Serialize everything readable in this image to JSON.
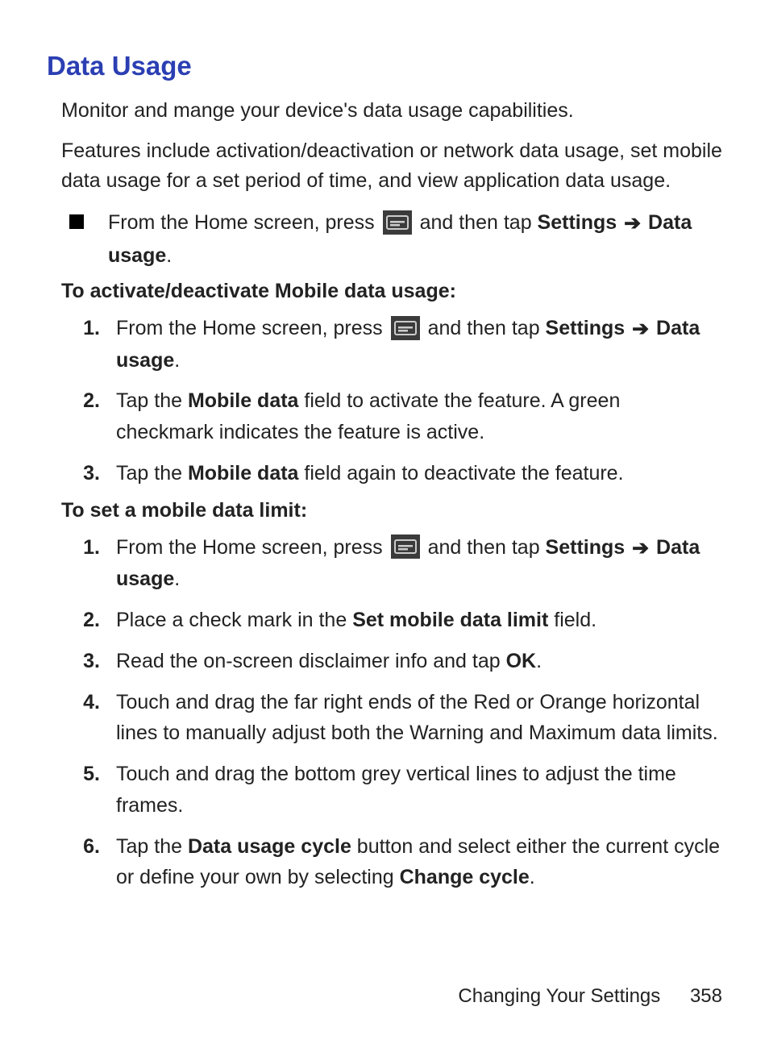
{
  "title": "Data Usage",
  "intro1": "Monitor and mange your device's data usage capabilities.",
  "intro2": "Features include activation/deactivation or network data usage, set mobile data usage for a set period of time, and view application data usage.",
  "txt": {
    "from_home": "From the Home screen, press ",
    "and_then_tap": " and then tap ",
    "settings": "Settings",
    "data_usage": "Data usage",
    "period": "."
  },
  "subhead1": "To activate/deactivate Mobile data usage:",
  "subhead2": "To set a mobile data limit:",
  "sec1_step2_a": "Tap the ",
  "sec1_step2_bold": "Mobile data",
  "sec1_step2_b": " field to activate the feature. A green checkmark indicates the feature is active.",
  "sec1_step3_a": "Tap the ",
  "sec1_step3_bold": "Mobile data",
  "sec1_step3_b": " field again to deactivate the feature.",
  "sec2_step2_a": "Place a check mark in the ",
  "sec2_step2_bold": "Set mobile data limit",
  "sec2_step2_b": " field.",
  "sec2_step3_a": "Read the on-screen disclaimer info and tap ",
  "sec2_step3_bold": "OK",
  "sec2_step3_b": ".",
  "sec2_step4": "Touch and drag the far right ends of the Red or Orange horizontal lines to manually adjust both the Warning and Maximum data limits.",
  "sec2_step5": "Touch and drag the bottom grey vertical lines to adjust the time frames.",
  "sec2_step6_a": "Tap the ",
  "sec2_step6_bold1": "Data usage cycle",
  "sec2_step6_b": " button and select either the current cycle or define your own by selecting ",
  "sec2_step6_bold2": "Change cycle",
  "sec2_step6_c": ".",
  "nums": {
    "n1": "1.",
    "n2": "2.",
    "n3": "3.",
    "n4": "4.",
    "n5": "5.",
    "n6": "6."
  },
  "footer": {
    "section": "Changing Your Settings",
    "page": "358"
  }
}
